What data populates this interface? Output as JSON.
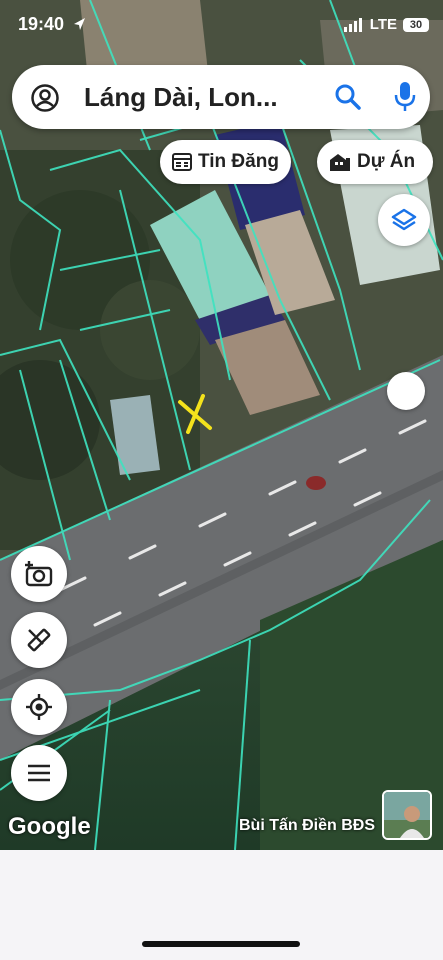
{
  "status": {
    "time": "19:40",
    "network": "LTE",
    "battery": "30"
  },
  "search": {
    "query": "Láng Dài, Lon..."
  },
  "chips": {
    "listings": "Tin Đăng",
    "projects": "Dự Án"
  },
  "attribution": {
    "provider": "Google",
    "author": "Bùi Tấn Điền BĐS"
  },
  "icons": {
    "account": "account-circle-icon",
    "search": "search-icon",
    "mic": "microphone-icon",
    "layers": "layers-icon",
    "camera": "add-photo-icon",
    "ruler": "measure-icon",
    "locate": "my-location-icon",
    "menu": "menu-icon"
  },
  "colors": {
    "parcel_lines": "#3ee3c0",
    "marker": "#f4e21c",
    "icon_blue": "#1a73e8"
  }
}
